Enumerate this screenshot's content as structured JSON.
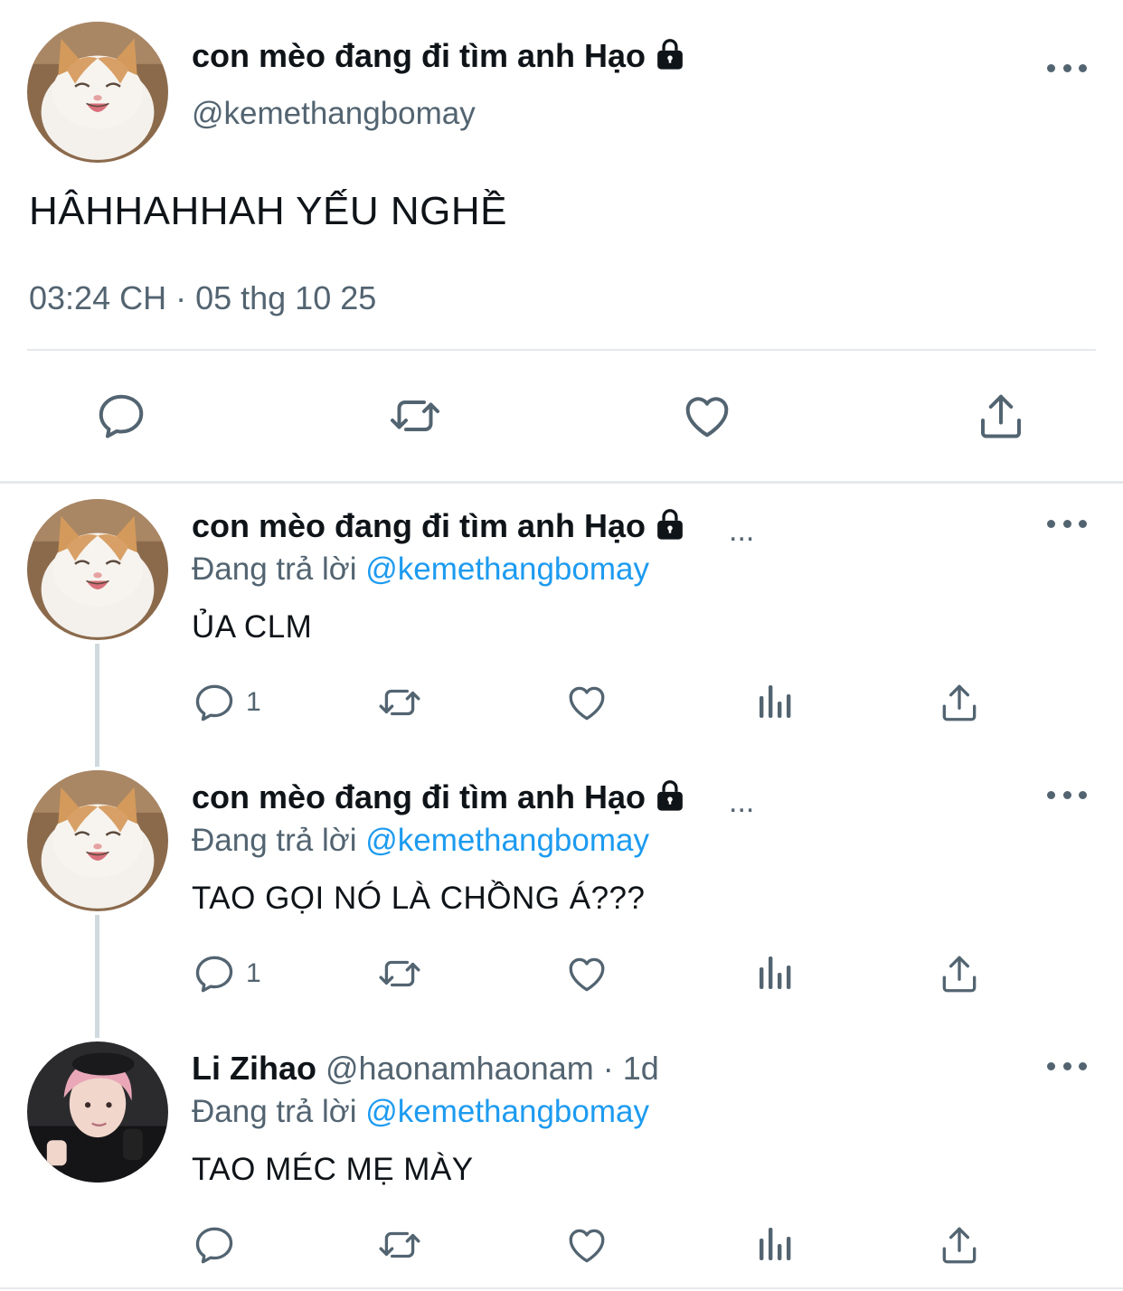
{
  "main_tweet": {
    "display_name": "con mèo đang đi tìm anh Hạo",
    "handle": "@kemethangbomay",
    "text": "HÂHHAHHAH YẾU NGHỀ",
    "timestamp": "03:24 CH · 05 thg 10 25",
    "protected": true
  },
  "replies": [
    {
      "display_name": "con mèo đang đi tìm anh Hạo",
      "name_overflow": "...",
      "reply_label": "Đang trả lời",
      "reply_to": "@kemethangbomay",
      "text": "ỦA CLM",
      "reply_count": "1"
    },
    {
      "display_name": "con mèo đang đi tìm anh Hạo",
      "name_overflow": "...",
      "reply_label": "Đang trả lời",
      "reply_to": "@kemethangbomay",
      "text": "TAO GỌI NÓ LÀ CHỒNG Á???",
      "reply_count": "1"
    },
    {
      "display_name": "Li Zihao",
      "handle": "@haonamhaonam",
      "time": "· 1d",
      "reply_label": "Đang trả lời",
      "reply_to": "@kemethangbomay",
      "text": "TAO MÉC MẸ MÀY",
      "reply_count": ""
    }
  ],
  "icons": {
    "reply": "reply-icon",
    "retweet": "retweet-icon",
    "like": "like-icon",
    "views": "views-icon",
    "share": "share-icon",
    "more": "more-icon",
    "lock": "lock-icon"
  },
  "colors": {
    "text": "#0f1419",
    "secondary": "#536471",
    "mention": "#1d9bf0",
    "divider": "#e6e9ec",
    "thread_line": "#cfd9de"
  }
}
